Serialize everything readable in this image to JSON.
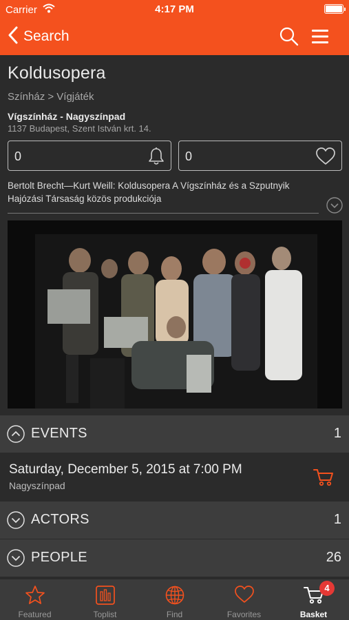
{
  "status_bar": {
    "carrier": "Carrier",
    "time": "4:17 PM"
  },
  "nav": {
    "back_label": "Search"
  },
  "show": {
    "title": "Koldusopera",
    "breadcrumb": "Színház > Vígjáték",
    "venue": "Vígszínház - Nagyszínpad",
    "address": "1137 Budapest, Szent István krt. 14.",
    "reminder_count": "0",
    "favorite_count": "0",
    "description": "Bertolt Brecht—Kurt Weill: Koldusopera A Vígszínház és a Szputnyik Hajózási Társaság közös produkciója"
  },
  "sections": {
    "events": {
      "label": "EVENTS",
      "count": "1"
    },
    "actors": {
      "label": "ACTORS",
      "count": "1"
    },
    "people": {
      "label": "PEOPLE",
      "count": "26"
    }
  },
  "event": {
    "date": "Saturday, December 5, 2015 at 7:00 PM",
    "place": "Nagyszínpad"
  },
  "tabs": [
    {
      "label": "Featured",
      "icon": "star-icon"
    },
    {
      "label": "Toplist",
      "icon": "toplist-icon"
    },
    {
      "label": "Find",
      "icon": "globe-icon"
    },
    {
      "label": "Favorites",
      "icon": "heart-icon"
    },
    {
      "label": "Basket",
      "icon": "cart-icon"
    }
  ],
  "basket_badge": "4",
  "colors": {
    "accent": "#f4511e",
    "background": "#2b2b2b",
    "section": "#3d3d3d",
    "tabbar": "#3b3b3b",
    "badge": "#e53935"
  }
}
